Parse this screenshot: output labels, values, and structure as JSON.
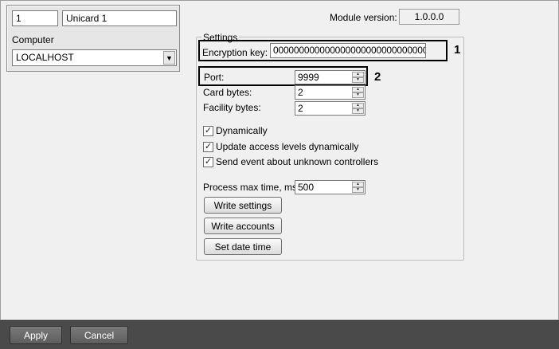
{
  "object": {
    "id": "1",
    "name": "Unicard 1",
    "computer_label": "Computer",
    "computer_value": "LOCALHOST"
  },
  "module_version": {
    "label": "Module version:",
    "value": "1.0.0.0"
  },
  "settings": {
    "group_label": "Settings",
    "encryption_key": {
      "label": "Encryption key:",
      "value": "00000000000000000000000000000000"
    },
    "port": {
      "label": "Port:",
      "value": "9999"
    },
    "card_bytes": {
      "label": "Card bytes:",
      "value": "2"
    },
    "facility_bytes": {
      "label": "Facility bytes:",
      "value": "2"
    },
    "checkboxes": [
      {
        "label": "Dynamically",
        "checked": true
      },
      {
        "label": "Update access levels dynamically",
        "checked": true
      },
      {
        "label": "Send event about unknown controllers",
        "checked": true
      }
    ],
    "process_max_time": {
      "label": "Process max time, ms:",
      "value": "500"
    },
    "buttons": {
      "write_settings": "Write settings",
      "write_accounts": "Write accounts",
      "set_date_time": "Set date time"
    }
  },
  "callouts": {
    "one": "1",
    "two": "2"
  },
  "footer": {
    "apply": "Apply",
    "cancel": "Cancel"
  },
  "icons": {
    "check": "check-icon",
    "dropdown": "chevron-down-icon",
    "spin_up": "spin-up-icon",
    "spin_down": "spin-down-icon"
  }
}
